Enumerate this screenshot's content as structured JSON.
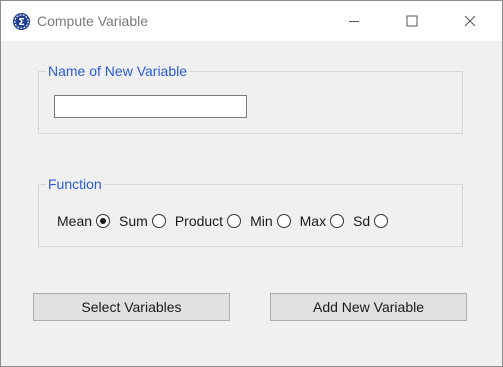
{
  "window": {
    "title": "Compute Variable",
    "app_icon": "sigma-gear-icon",
    "controls": [
      "minimize-icon",
      "maximize-icon",
      "close-icon"
    ]
  },
  "new_variable": {
    "group_label": "Name of New Variable",
    "value": ""
  },
  "function": {
    "group_label": "Function",
    "options": [
      {
        "label": "Mean",
        "checked": true
      },
      {
        "label": "Sum",
        "checked": false
      },
      {
        "label": "Product",
        "checked": false
      },
      {
        "label": "Min",
        "checked": false
      },
      {
        "label": "Max",
        "checked": false
      },
      {
        "label": "Sd",
        "checked": false
      }
    ]
  },
  "buttons": {
    "select_variables": "Select Variables",
    "add_new_variable": "Add New Variable"
  },
  "colors": {
    "accent": "#2a5bd7",
    "window_bg": "#f0f0f0",
    "button_bg": "#e1e1e1"
  }
}
